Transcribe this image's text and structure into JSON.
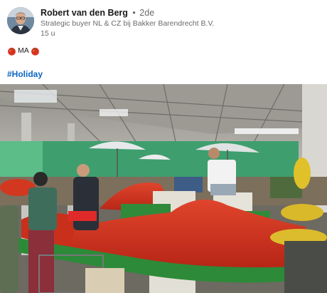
{
  "post": {
    "author_name": "Robert van den Berg",
    "separator": "•",
    "degree": "2de",
    "headline": "Strategic buyer NL & CZ bij Bakker Barendrecht B.V.",
    "time_ago": "15 u",
    "body_text": "MA",
    "hashtag": "#Holiday"
  },
  "icons": {
    "emoji_left": "tomato-icon",
    "emoji_right": "tomato-icon"
  },
  "colors": {
    "hashtag": "#0a66c2",
    "tomato": "#d9331f"
  }
}
